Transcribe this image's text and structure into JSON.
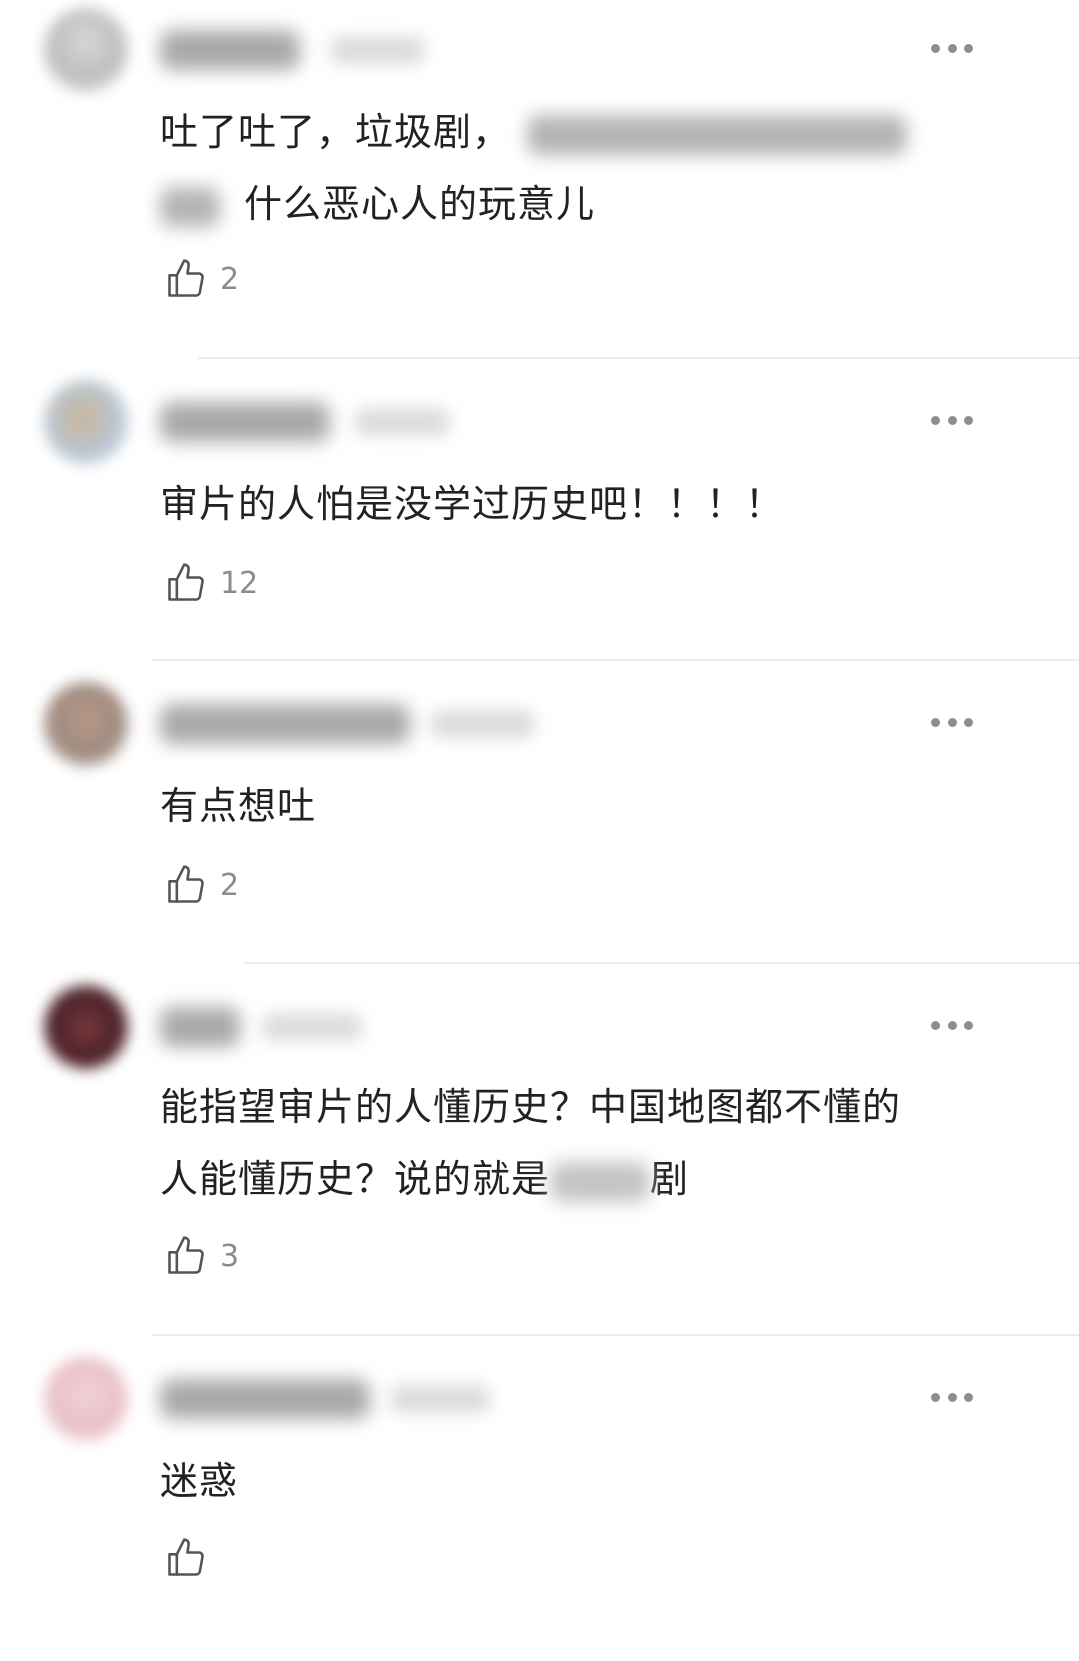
{
  "comments": [
    {
      "text_a": "吐了吐了，垃圾剧，",
      "text_b": "什么恶心人的玩意儿",
      "likes": "2",
      "icons": {
        "more": "more-dots-icon",
        "like": "thumbs-up-icon"
      }
    },
    {
      "text": "审片的人怕是没学过历史吧！！！！",
      "likes": "12"
    },
    {
      "text": "有点想吐",
      "likes": "2"
    },
    {
      "line1": "能指望审片的人懂历史？中国地图都不懂的",
      "line2_a": "人能懂历史？说的就是",
      "line2_b": "剧",
      "likes": "3"
    },
    {
      "text": "迷惑",
      "likes": ""
    }
  ]
}
